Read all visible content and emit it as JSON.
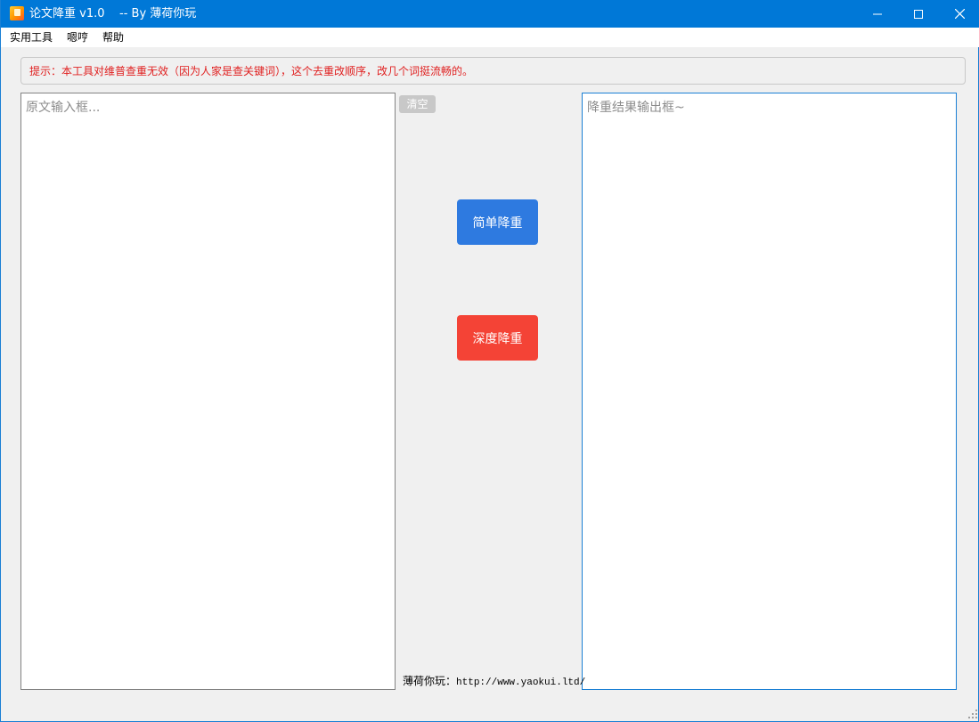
{
  "window": {
    "title": "论文降重 v1.0    -- By 薄荷你玩",
    "controls": {
      "minimize_icon": "minimize-icon",
      "maximize_icon": "maximize-icon",
      "close_icon": "close-icon"
    }
  },
  "menu": {
    "items": [
      "实用工具",
      "嗯哼",
      "帮助"
    ]
  },
  "tip": {
    "text": "提示：本工具对维普查重无效（因为人家是查关键词），这个去重改顺序，改几个词挺流畅的。"
  },
  "input": {
    "placeholder": "原文输入框...",
    "value": ""
  },
  "output": {
    "placeholder": "降重结果输出框~",
    "value": ""
  },
  "buttons": {
    "clear_label": "清空",
    "simple_label": "简单降重",
    "deep_label": "深度降重"
  },
  "footer": {
    "label": "薄荷你玩：",
    "url": "http://www.yaokui.ltd/"
  },
  "colors": {
    "titlebar": "#0078d7",
    "tip_text": "#e02020",
    "simple_button": "#2e7ae0",
    "deep_button": "#f44336",
    "clear_button": "#c8c8c8"
  }
}
